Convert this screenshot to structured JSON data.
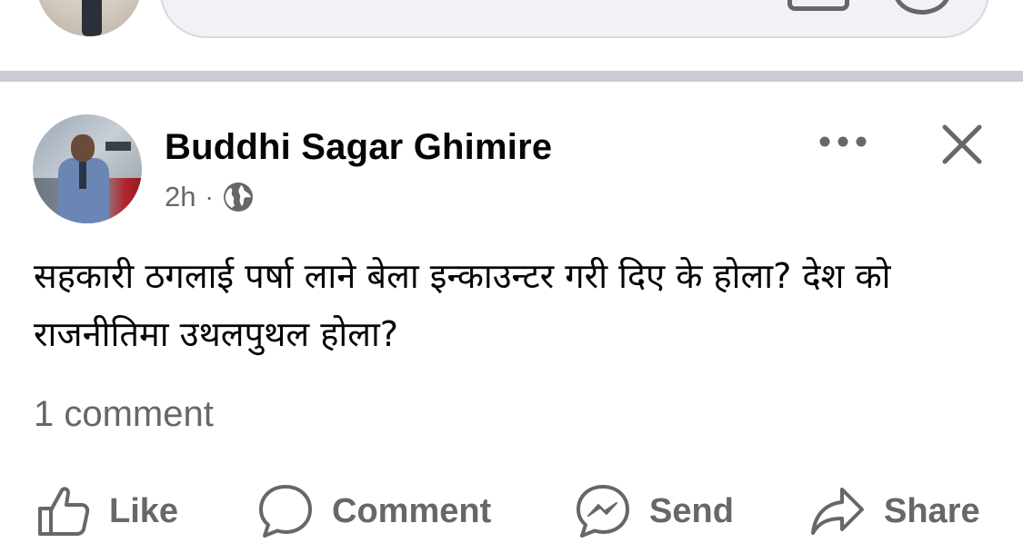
{
  "post": {
    "author": "Buddhi Sagar Ghimire",
    "time": "2h",
    "separator": "·",
    "text": "सहकारी ठगलाई पर्षा लाने बेला इन्काउन्टर गरी दिए के होला? देश को राजनीतिमा उथलपुथल होला?",
    "comment_count": "1 comment"
  },
  "actions": {
    "like": "Like",
    "comment": "Comment",
    "send": "Send",
    "share": "Share"
  },
  "icons": {
    "audience": "globe-icon",
    "more": "more-icon",
    "close": "close-icon",
    "like": "thumbs-up-icon",
    "comment": "comment-bubble-icon",
    "send": "messenger-icon",
    "share": "share-arrow-icon"
  },
  "colors": {
    "text_primary": "#050505",
    "text_secondary": "#65676b",
    "divider": "#c9ccd1",
    "composer_bg": "#f0f2f5"
  }
}
